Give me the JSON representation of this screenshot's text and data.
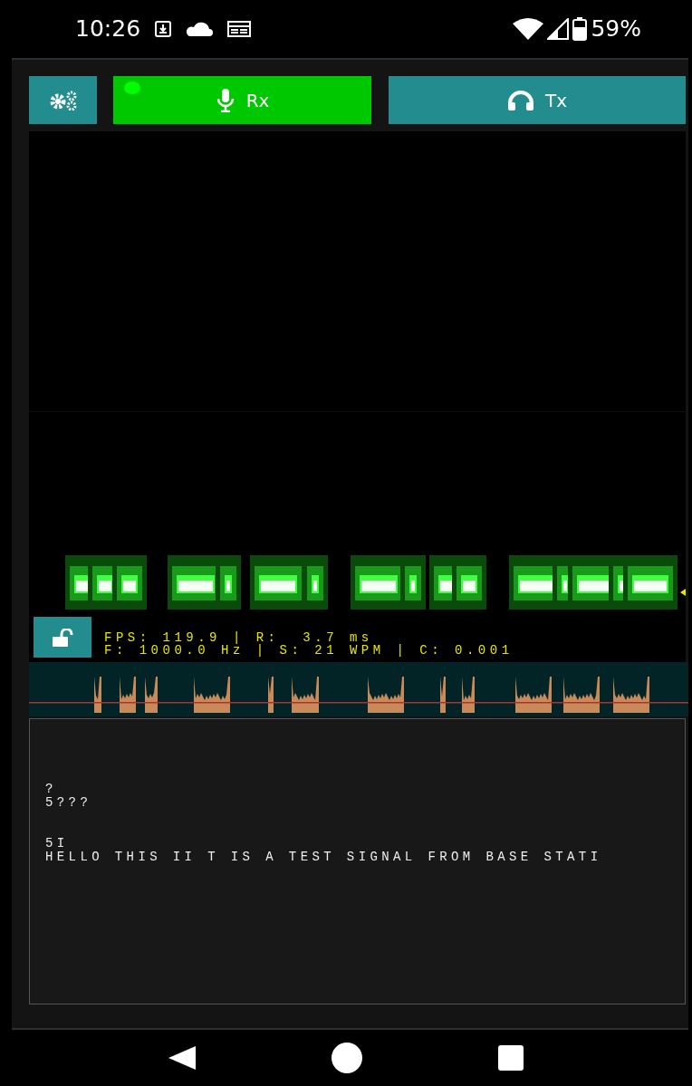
{
  "status_bar": {
    "time": "10:26",
    "battery": "59%"
  },
  "toolbar": {
    "tabs": [
      {
        "label": "Rx",
        "selected": true,
        "kind": "receive"
      },
      {
        "label": "Tx",
        "selected": false,
        "kind": "transmit"
      }
    ]
  },
  "lock": {
    "locked": false
  },
  "stats": [
    "FPS: 119.9 | R:  3.7 ms",
    "F: 1000.0 Hz | S: 21 WPM | C: 0.001"
  ],
  "decoded_text": [
    {
      "lines": [
        "?",
        "5???"
      ]
    },
    {
      "lines": [
        "5I",
        "HELLO THIS II T IS A TEST SIGNAL FROM BASE STATI"
      ]
    }
  ]
}
